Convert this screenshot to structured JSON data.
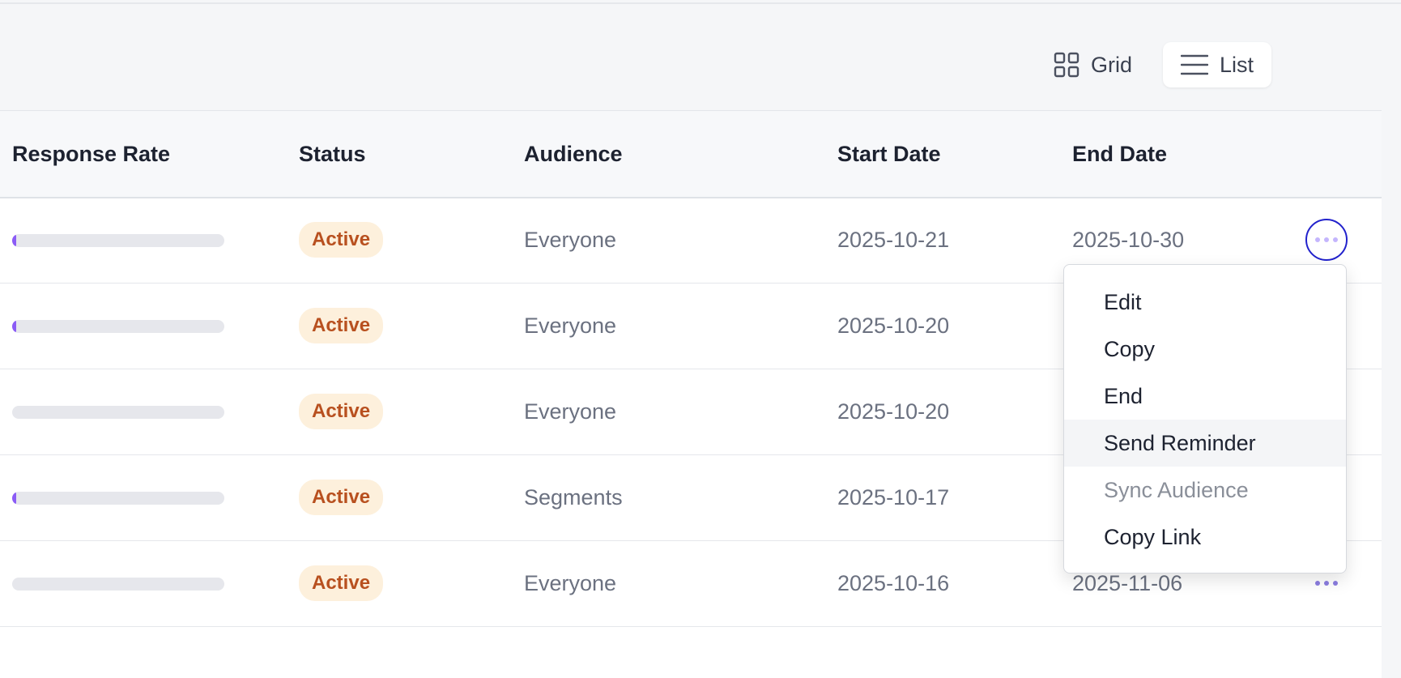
{
  "view_toggle": {
    "grid_label": "Grid",
    "list_label": "List",
    "active": "List"
  },
  "table": {
    "columns": [
      "Response Rate",
      "Status",
      "Audience",
      "Start Date",
      "End Date"
    ],
    "rows": [
      {
        "response_rate": 0.02,
        "status": "Active",
        "audience": "Everyone",
        "start_date": "2025-10-21",
        "end_date": "2025-10-30"
      },
      {
        "response_rate": 0.02,
        "status": "Active",
        "audience": "Everyone",
        "start_date": "2025-10-20",
        "end_date": ""
      },
      {
        "response_rate": 0,
        "status": "Active",
        "audience": "Everyone",
        "start_date": "2025-10-20",
        "end_date": ""
      },
      {
        "response_rate": 0.02,
        "status": "Active",
        "audience": "Segments",
        "start_date": "2025-10-17",
        "end_date": ""
      },
      {
        "response_rate": 0,
        "status": "Active",
        "audience": "Everyone",
        "start_date": "2025-10-16",
        "end_date": "2025-11-06"
      }
    ]
  },
  "row_menu": {
    "items": [
      {
        "label": "Edit"
      },
      {
        "label": "Copy"
      },
      {
        "label": "End"
      },
      {
        "label": "Send Reminder"
      },
      {
        "label": "Sync Audience"
      },
      {
        "label": "Copy Link"
      }
    ]
  },
  "colors": {
    "accent": "#8b5cf6",
    "badge_bg": "#fdf0dc",
    "badge_text": "#b8501f",
    "focus_ring": "#2222cc"
  }
}
